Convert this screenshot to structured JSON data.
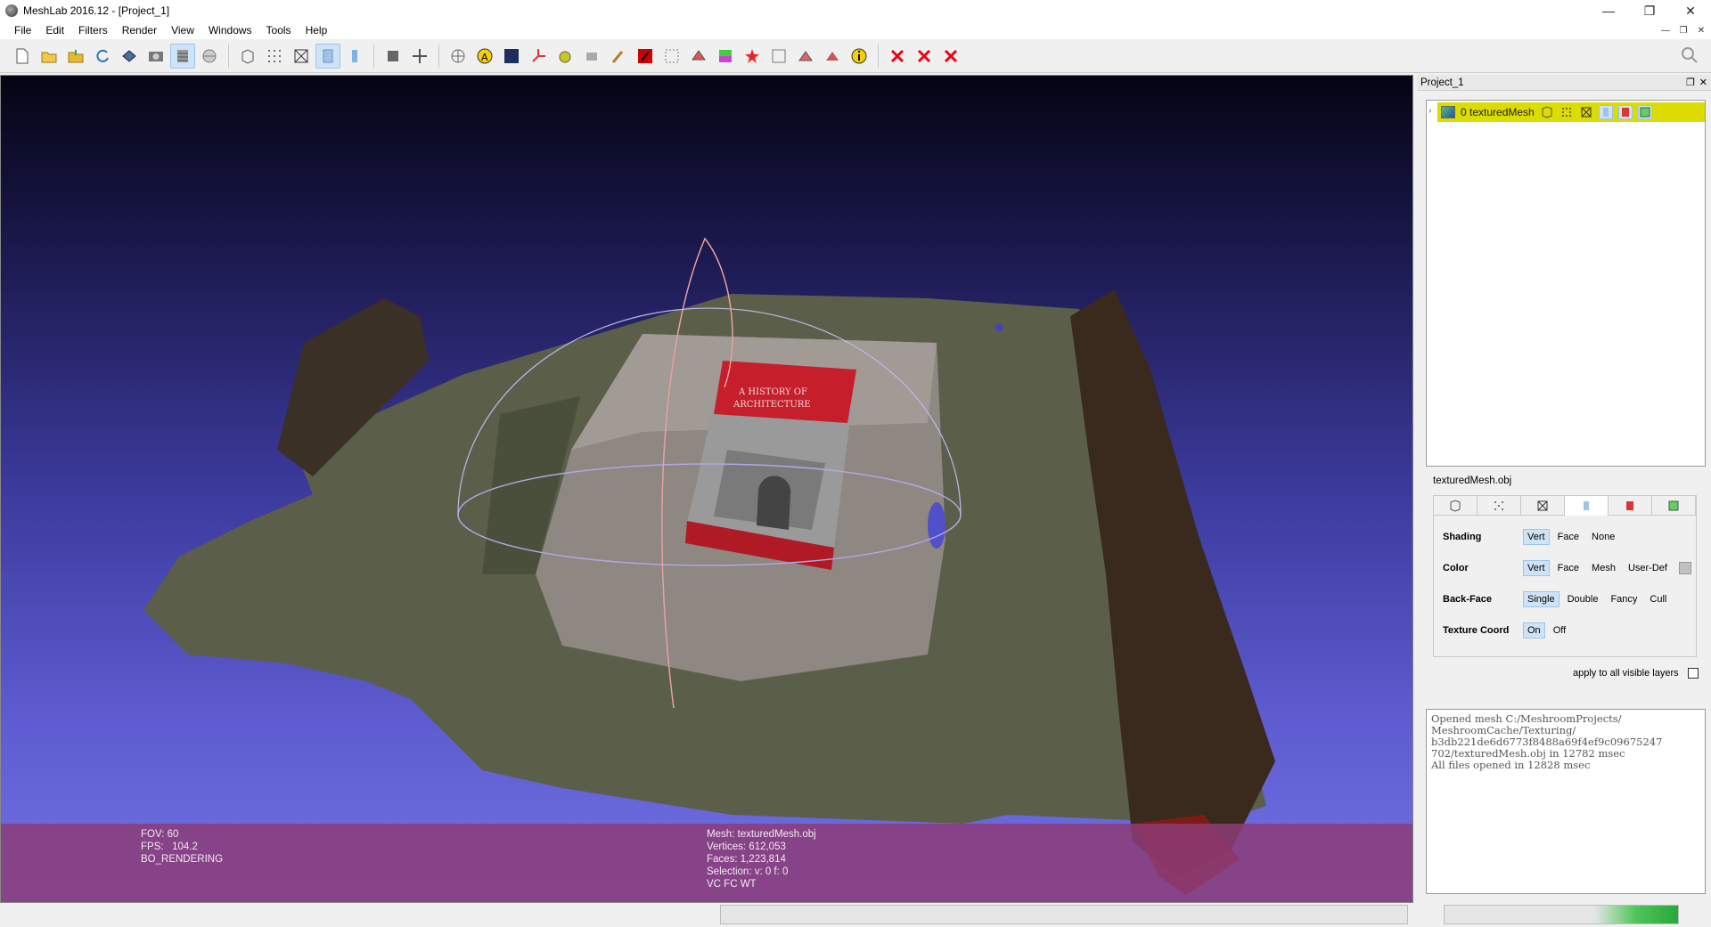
{
  "window": {
    "title": "MeshLab 2016.12 - [Project_1]",
    "minimize": "—",
    "restore": "❐",
    "close": "✕"
  },
  "menu": [
    "File",
    "Edit",
    "Filters",
    "Render",
    "View",
    "Windows",
    "Tools",
    "Help"
  ],
  "mdi_controls": [
    "—",
    "❐",
    "✕"
  ],
  "viewport": {
    "fov": "FOV: 60",
    "fps": "FPS:   104.2",
    "rendering": "BO_RENDERING",
    "mesh": "Mesh: texturedMesh.obj",
    "vertices": "Vertices: 612,053",
    "faces": "Faces: 1,223,814",
    "selection": "Selection: v: 0 f: 0",
    "flags": "VC FC WT",
    "colors": {
      "bg_top": "#040414",
      "bg_bottom": "#7272e4",
      "info_bar": "#8c3c78"
    }
  },
  "book": {
    "line1": "A HISTORY OF",
    "line2": "ARCHITECTURE"
  },
  "right_panel": {
    "project": "Project_1",
    "layer": {
      "index_name": "0  texturedMesh",
      "highlight": "#dcdc00"
    },
    "mesh_file": "texturedMesh.obj",
    "shading": {
      "label": "Shading",
      "options": [
        "Vert",
        "Face",
        "None"
      ],
      "selected": "Vert"
    },
    "color": {
      "label": "Color",
      "options": [
        "Vert",
        "Face",
        "Mesh",
        "User-Def"
      ],
      "selected": "Vert"
    },
    "backface": {
      "label": "Back-Face",
      "options": [
        "Single",
        "Double",
        "Fancy",
        "Cull"
      ],
      "selected": "Single"
    },
    "texcoord": {
      "label": "Texture Coord",
      "options": [
        "On",
        "Off"
      ],
      "selected": "On"
    },
    "apply_all": "apply to all visible layers",
    "log": "Opened mesh C:/MeshroomProjects/\nMeshroomCache/Texturing/\nb3db221de6d6773f8488a69f4ef9c09675247\n702/texturedMesh.obj in 12782 msec\nAll files opened in 12828 msec"
  }
}
